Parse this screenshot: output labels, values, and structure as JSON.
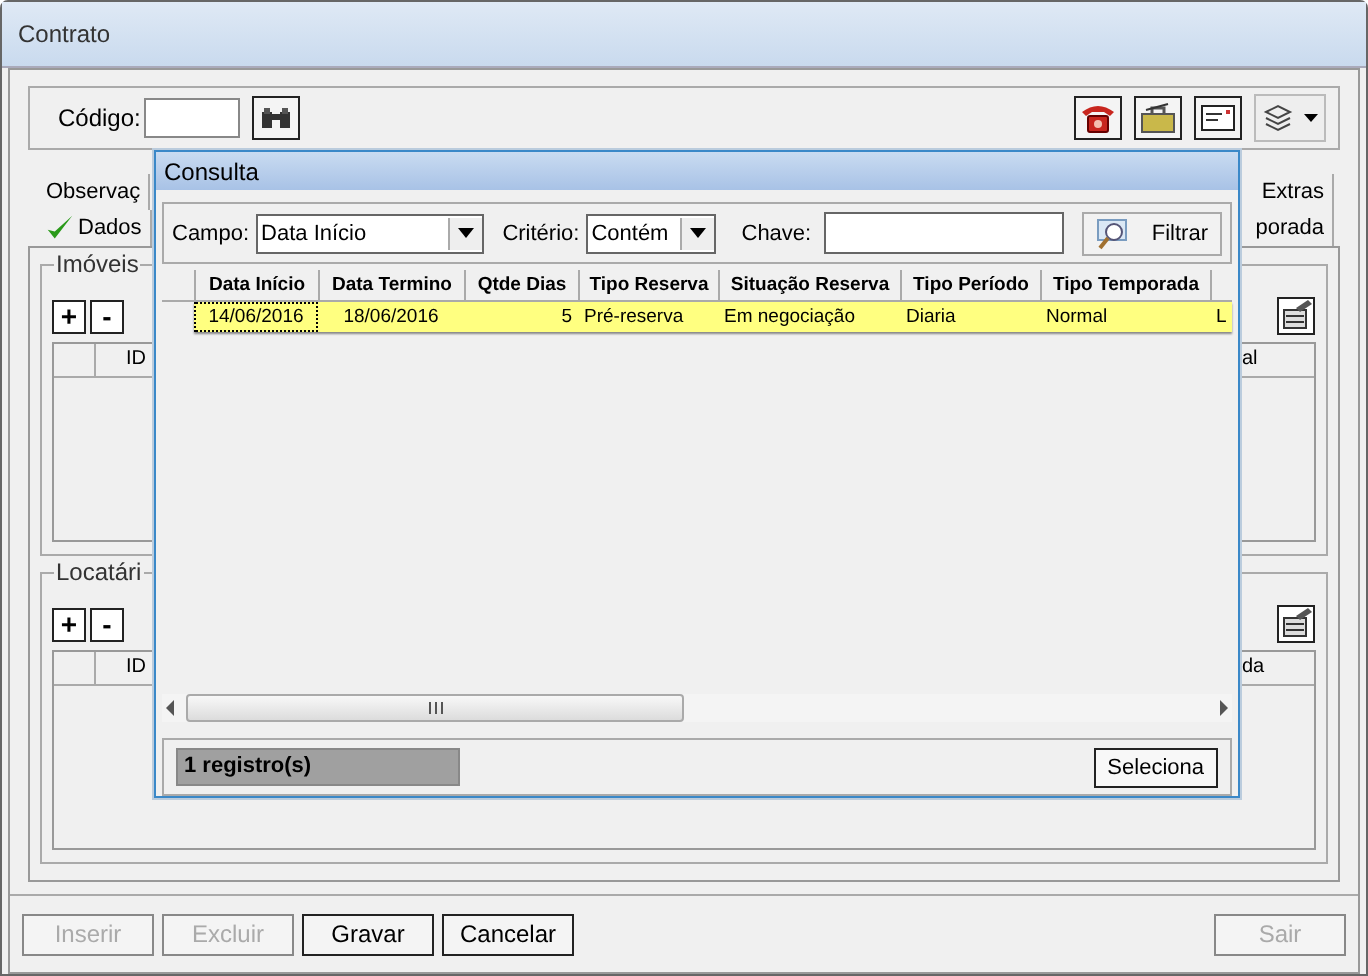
{
  "window": {
    "title": "Contrato"
  },
  "toolbar": {
    "code_label": "Código:"
  },
  "tabs_row_1": [
    {
      "label": "Observaç",
      "checked": false
    },
    {
      "label": "Extras",
      "checked": false
    }
  ],
  "tabs_row_2": [
    {
      "label": "Dados",
      "checked": true
    },
    {
      "label": "porada",
      "checked": false
    }
  ],
  "groups": [
    {
      "title": "Imóveis",
      "add_label": "+",
      "remove_label": "-",
      "columns": [
        "ID",
        "al"
      ]
    },
    {
      "title": "Locatári",
      "add_label": "+",
      "remove_label": "-",
      "columns": [
        "ID",
        "da"
      ]
    }
  ],
  "dialog": {
    "title": "Consulta",
    "campo_label": "Campo:",
    "campo_value": "Data Início",
    "criterio_label": "Critério:",
    "criterio_value": "Contém",
    "chave_label": "Chave:",
    "filter_button": "Filtrar",
    "columns": [
      "Data Início",
      "Data Termino",
      "Qtde Dias",
      "Tipo Reserva",
      "Situação Reserva",
      "Tipo Período",
      "Tipo Temporada"
    ],
    "rows": [
      {
        "selected": true,
        "cells": [
          "14/06/2016",
          "18/06/2016",
          "5",
          "Pré-reserva",
          "Em negociação",
          "Diaria",
          "Normal",
          "L"
        ]
      }
    ],
    "status": "1 registro(s)",
    "select_button": "Seleciona"
  },
  "buttons": [
    {
      "label": "Inserir",
      "disabled": true
    },
    {
      "label": "Excluir",
      "disabled": true
    },
    {
      "label": "Gravar",
      "disabled": false
    },
    {
      "label": "Cancelar",
      "disabled": false
    },
    {
      "label": "Sair",
      "disabled": true
    }
  ]
}
